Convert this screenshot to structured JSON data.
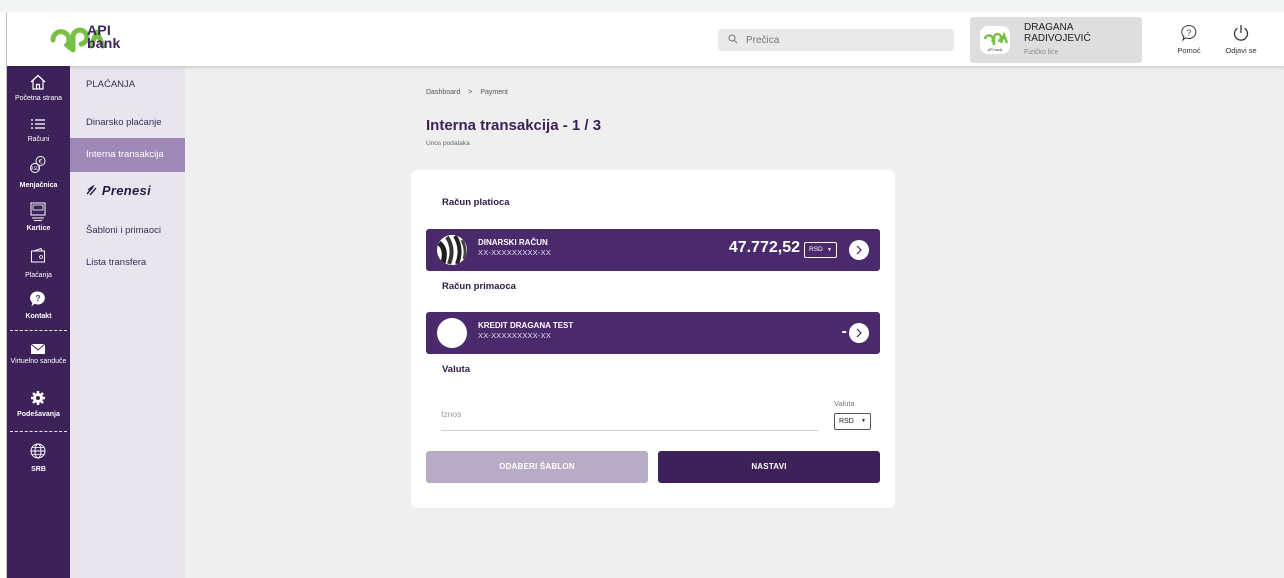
{
  "header": {
    "logo_text": "API\nbank",
    "logo_line1": "API",
    "logo_line2": "bank",
    "search_placeholder": "Prečica",
    "user": {
      "name": "DRAGANA RADIVOJEVIĆ",
      "role": "Fizičko lice",
      "avatar_text": "API bank"
    },
    "help_label": "Pomoć",
    "logout_label": "Odjavi se"
  },
  "rail": {
    "items": [
      {
        "label": "Početna strana",
        "icon": "home-icon"
      },
      {
        "label": "Računi",
        "icon": "list-icon"
      },
      {
        "label": "Menjačnica",
        "icon": "exchange-icon"
      },
      {
        "label": "Kartice",
        "icon": "card-icon"
      },
      {
        "label": "Plaćanja",
        "icon": "payments-icon"
      },
      {
        "label": "Kontakt",
        "icon": "chat-icon"
      },
      {
        "label": "Virtuelno sanduče",
        "icon": "mail-icon"
      },
      {
        "label": "Podešavanja",
        "icon": "gear-icon"
      },
      {
        "label": "SRB",
        "icon": "globe-icon"
      }
    ]
  },
  "submenu": {
    "title": "PLAĆANJA",
    "items": [
      "Dinarsko plaćanje",
      "Interna transakcija"
    ],
    "prenesi": "Prenesi",
    "items_after": [
      "Šabloni i primaoci",
      "Lista transfera"
    ],
    "active": "Interna transakcija"
  },
  "breadcrumb": {
    "items": [
      "Dashboard",
      "Payment"
    ],
    "separator": ">"
  },
  "page": {
    "title": "Interna transakcija - 1 / 3",
    "subtitle": "Unos podataka"
  },
  "form": {
    "payer_label": "Račun platioca",
    "payer": {
      "name": "DINARSKI RAČUN",
      "number": "XX-XXXXXXXXX-XX",
      "amount": "47.772,52",
      "currency": "RSD"
    },
    "recipient_label": "Račun primaoca",
    "recipient": {
      "name": "KREDIT DRAGANA TEST",
      "number": "XX-XXXXXXXXX-XX",
      "amount": "-"
    },
    "currency_section_label": "Valuta",
    "amount_placeholder": "Iznos",
    "currency_field_label": "Valuta",
    "currency_value": "RSD",
    "template_button": "ODABERI ŠABLON",
    "next_button": "NASTAVI"
  },
  "colors": {
    "brand_purple": "#3c2259",
    "card_purple": "#4a2a6a",
    "submenu_active": "#9f88b7",
    "logo_green": "#76c043"
  }
}
